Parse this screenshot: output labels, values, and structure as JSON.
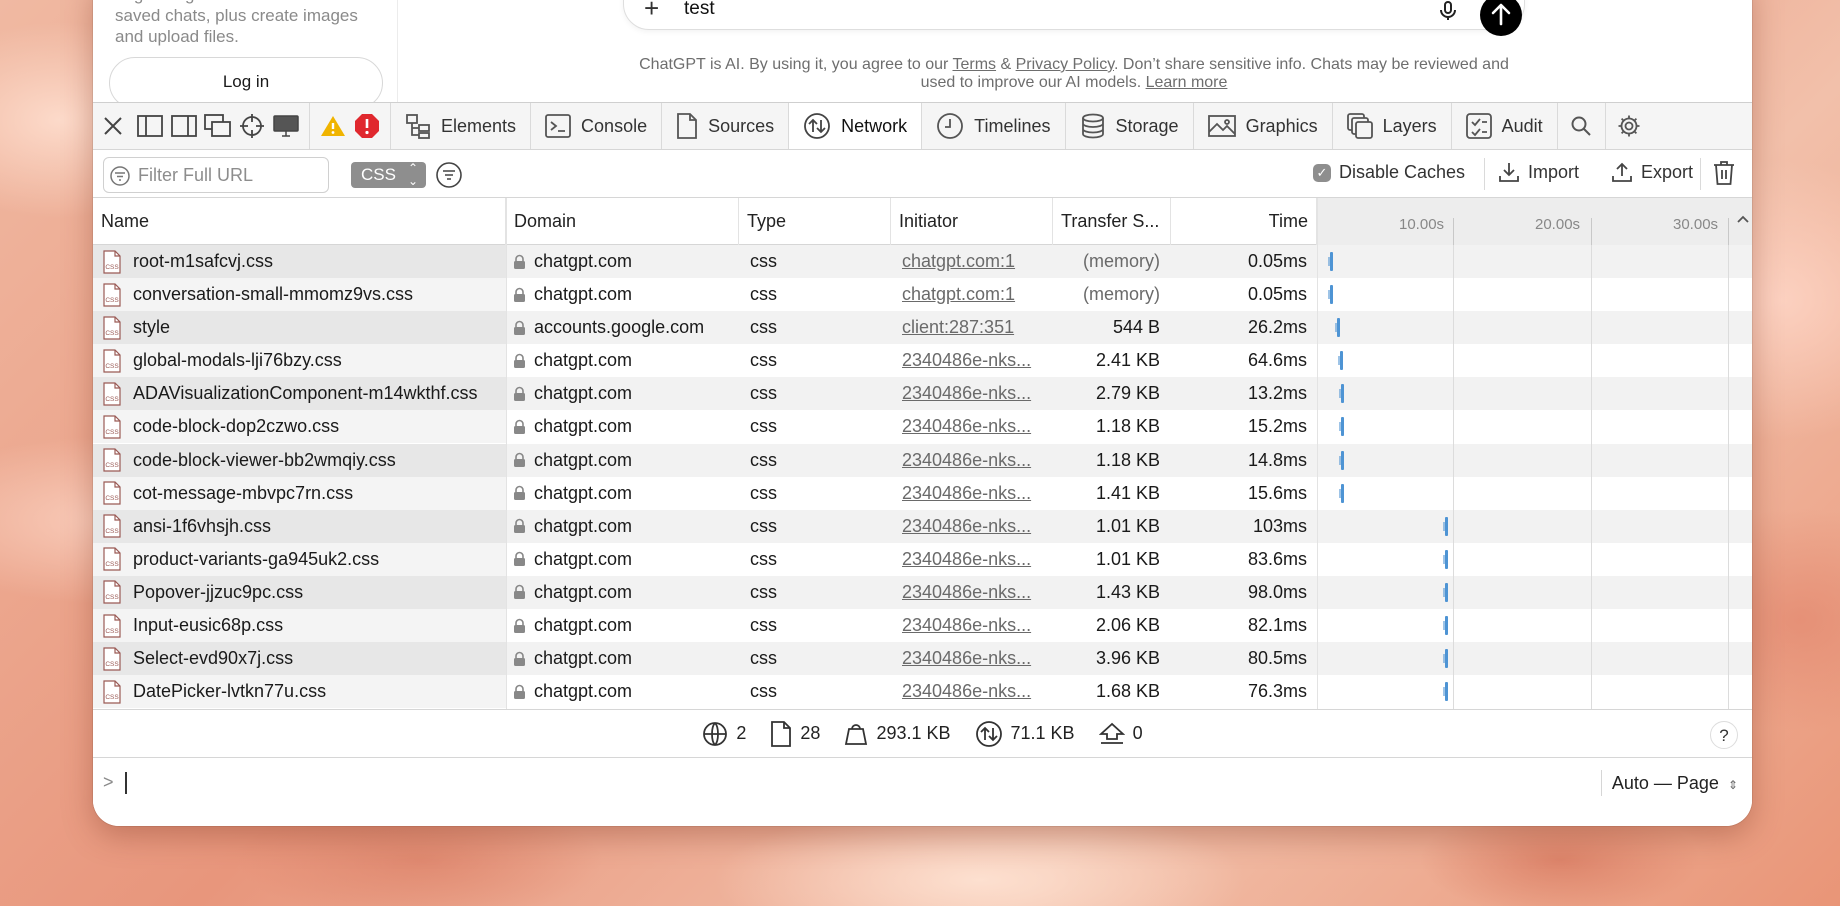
{
  "page": {
    "side_text": "Log in to get answers based on saved chats, plus create images and upload files.",
    "login_label": "Log in",
    "composer_value": "test",
    "disclaimer_pre": "ChatGPT is AI. By using it, you agree to our ",
    "terms": "Terms",
    "amp": " & ",
    "privacy": "Privacy Policy",
    "disclaimer_mid": ". Don’t share sensitive info. Chats may be reviewed and used to improve our AI models. ",
    "learn_more": "Learn more"
  },
  "devtools": {
    "tabs": [
      {
        "label": "Elements",
        "icon": "elements-icon"
      },
      {
        "label": "Console",
        "icon": "console-icon"
      },
      {
        "label": "Sources",
        "icon": "sources-icon"
      },
      {
        "label": "Network",
        "icon": "network-icon",
        "active": true
      },
      {
        "label": "Timelines",
        "icon": "timelines-icon"
      },
      {
        "label": "Storage",
        "icon": "storage-icon"
      },
      {
        "label": "Graphics",
        "icon": "graphics-icon"
      },
      {
        "label": "Layers",
        "icon": "layers-icon"
      },
      {
        "label": "Audit",
        "icon": "audit-icon"
      }
    ],
    "filter_placeholder": "Filter Full URL",
    "type_filter": "CSS",
    "disable_caches": "Disable Caches",
    "disable_caches_checked": true,
    "import_label": "Import",
    "export_label": "Export",
    "columns": {
      "name": "Name",
      "domain": "Domain",
      "type": "Type",
      "initiator": "Initiator",
      "transfer": "Transfer S...",
      "time": "Time"
    },
    "waterfall_ticks": [
      "10.00s",
      "20.00s",
      "30.00s"
    ],
    "rows": [
      {
        "name": "root-m1safcvj.css",
        "domain": "chatgpt.com",
        "type": "css",
        "initiator": "chatgpt.com:1",
        "transfer": "(memory)",
        "time": "0.05ms",
        "start_s": 0.1
      },
      {
        "name": "conversation-small-mmomz9vs.css",
        "domain": "chatgpt.com",
        "type": "css",
        "initiator": "chatgpt.com:1",
        "transfer": "(memory)",
        "time": "0.05ms",
        "start_s": 0.1
      },
      {
        "name": "style",
        "domain": "accounts.google.com",
        "type": "css",
        "initiator": "client:287:351",
        "transfer": "544 B",
        "time": "26.2ms",
        "start_s": 0.6
      },
      {
        "name": "global-modals-lji76bzy.css",
        "domain": "chatgpt.com",
        "type": "css",
        "initiator": "2340486e-nks...",
        "transfer": "2.41 KB",
        "time": "64.6ms",
        "start_s": 0.8
      },
      {
        "name": "ADAVisualizationComponent-m14wkthf.css",
        "domain": "chatgpt.com",
        "type": "css",
        "initiator": "2340486e-nks...",
        "transfer": "2.79 KB",
        "time": "13.2ms",
        "start_s": 0.9
      },
      {
        "name": "code-block-dop2czwo.css",
        "domain": "chatgpt.com",
        "type": "css",
        "initiator": "2340486e-nks...",
        "transfer": "1.18 KB",
        "time": "15.2ms",
        "start_s": 0.9
      },
      {
        "name": "code-block-viewer-bb2wmqiy.css",
        "domain": "chatgpt.com",
        "type": "css",
        "initiator": "2340486e-nks...",
        "transfer": "1.18 KB",
        "time": "14.8ms",
        "start_s": 0.9
      },
      {
        "name": "cot-message-mbvpc7rn.css",
        "domain": "chatgpt.com",
        "type": "css",
        "initiator": "2340486e-nks...",
        "transfer": "1.41 KB",
        "time": "15.6ms",
        "start_s": 0.9
      },
      {
        "name": "ansi-1f6vhsjh.css",
        "domain": "chatgpt.com",
        "type": "css",
        "initiator": "2340486e-nks...",
        "transfer": "1.01 KB",
        "time": "103ms",
        "start_s": 8.5
      },
      {
        "name": "product-variants-ga945uk2.css",
        "domain": "chatgpt.com",
        "type": "css",
        "initiator": "2340486e-nks...",
        "transfer": "1.01 KB",
        "time": "83.6ms",
        "start_s": 8.5
      },
      {
        "name": "Popover-jjzuc9pc.css",
        "domain": "chatgpt.com",
        "type": "css",
        "initiator": "2340486e-nks...",
        "transfer": "1.43 KB",
        "time": "98.0ms",
        "start_s": 8.5
      },
      {
        "name": "Input-eusic68p.css",
        "domain": "chatgpt.com",
        "type": "css",
        "initiator": "2340486e-nks...",
        "transfer": "2.06 KB",
        "time": "82.1ms",
        "start_s": 8.5
      },
      {
        "name": "Select-evd90x7j.css",
        "domain": "chatgpt.com",
        "type": "css",
        "initiator": "2340486e-nks...",
        "transfer": "3.96 KB",
        "time": "80.5ms",
        "start_s": 8.5
      },
      {
        "name": "DatePicker-lvtkn77u.css",
        "domain": "chatgpt.com",
        "type": "css",
        "initiator": "2340486e-nks...",
        "transfer": "1.68 KB",
        "time": "76.3ms",
        "start_s": 8.5
      }
    ],
    "status": {
      "domains": "2",
      "resources": "28",
      "size": "293.1 KB",
      "transferred": "71.1 KB",
      "errors": "0"
    },
    "help": "?",
    "console_prompt": ">",
    "context": "Auto — Page"
  },
  "colors": {
    "accent_bar": "#4e94d4",
    "warning": "#f0b400",
    "error": "#e0282e"
  }
}
